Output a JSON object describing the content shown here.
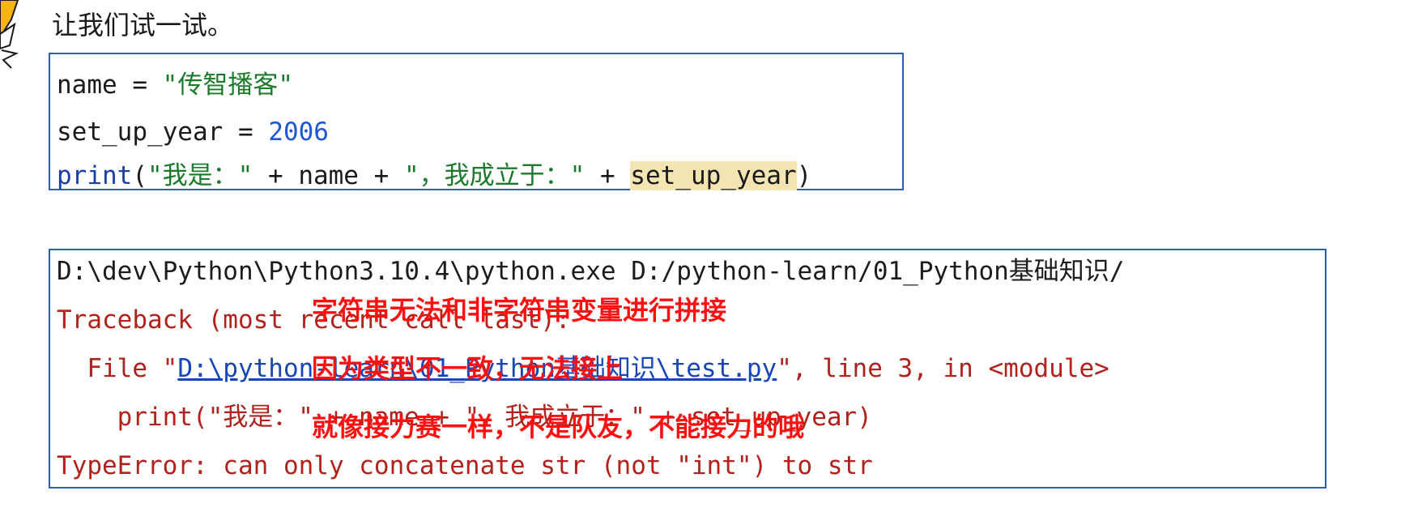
{
  "intro_text": "让我们试一试。",
  "code": {
    "line1": {
      "var": "name",
      "op": " = ",
      "str": "\"传智播客\""
    },
    "line2": {
      "var": "set_up_year",
      "op": " = ",
      "num": "2006"
    },
    "line3": {
      "fn": "print",
      "open": "(",
      "s1": "\"我是：\"",
      "plus1": " + name + ",
      "s2": "\"，我成立于：\"",
      "plus2": " + ",
      "hl": "set_up_year",
      "close": ")"
    }
  },
  "terminal": {
    "line1_a": "D:\\dev\\Python\\Python3.10.4\\python.exe D:/python-learn/01_Python基础知识/",
    "line2": "Traceback (most recent call last):",
    "line3_a": "  File \"",
    "line3_link": "D:\\python-learn\\01_Python基础知识\\test.py",
    "line3_b": "\", line 3, in <module>",
    "line4": "    print(\"我是：\" + name + \"，我成立于：\" + set_up_year)",
    "line5": "TypeError: can only concatenate str (not \"int\") to str"
  },
  "annotations": {
    "note1": "字符串无法和非字符串变量进行拼接",
    "note2": "因为类型不一致，无法接上",
    "note3": "就像接力赛一样，不是队友，不能接力的哦"
  },
  "colors": {
    "border": "#2e5fb8",
    "string": "#1b7a2b",
    "number": "#1f56d6",
    "error": "#b0221b",
    "annotation": "#ff1010",
    "highlight": "#f2e4b3"
  }
}
